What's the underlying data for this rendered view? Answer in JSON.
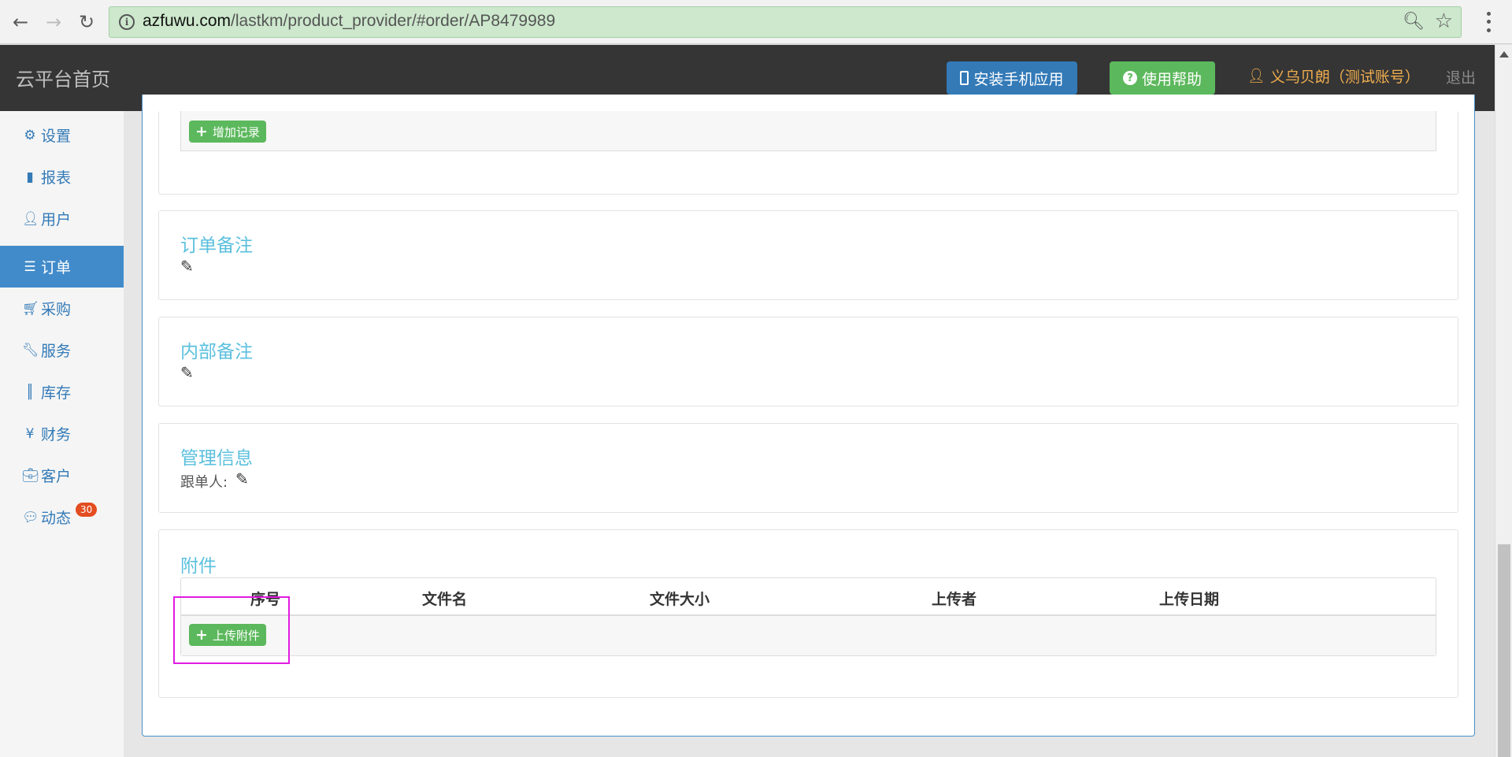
{
  "browser": {
    "url_host": "azfuwu.com",
    "url_path": "/lastkm/product_provider/#order/AP8479989",
    "icons": [
      "back-arrow",
      "forward-arrow",
      "reload",
      "info",
      "zoom",
      "star",
      "menu-dots"
    ]
  },
  "header": {
    "brand": "云平台首页",
    "install_app": "安装手机应用",
    "help": "使用帮助",
    "user": "义乌贝朗（测试账号）",
    "logout": "退出"
  },
  "sidebar": {
    "items": [
      {
        "label": "设置",
        "icon": "cog-icon"
      },
      {
        "label": "报表",
        "icon": "bar-chart-icon"
      },
      {
        "label": "用户",
        "icon": "user-icon"
      },
      {
        "label": "订单",
        "icon": "list-icon",
        "active": true
      },
      {
        "label": "采购",
        "icon": "cart-icon"
      },
      {
        "label": "服务",
        "icon": "wrench-icon"
      },
      {
        "label": "库存",
        "icon": "barcode-icon"
      },
      {
        "label": "财务",
        "icon": "yen-icon"
      },
      {
        "label": "客户",
        "icon": "briefcase-icon"
      },
      {
        "label": "动态",
        "icon": "comment-icon",
        "badge": "30"
      }
    ]
  },
  "main": {
    "add_record": "增加记录",
    "order_note": {
      "title": "订单备注"
    },
    "internal_note": {
      "title": "内部备注"
    },
    "management": {
      "title": "管理信息",
      "follower_label": "跟单人:"
    },
    "attachments": {
      "title": "附件",
      "columns": [
        "序号",
        "文件名",
        "文件大小",
        "上传者",
        "上传日期"
      ],
      "upload_button": "上传附件"
    }
  },
  "colors": {
    "header_bg": "#353535",
    "primary": "#337ab7",
    "success": "#5cb85c",
    "warning": "#f0ad4e",
    "info": "#5bc0de",
    "highlight": "#e21ae2",
    "badge": "#e34d20"
  }
}
